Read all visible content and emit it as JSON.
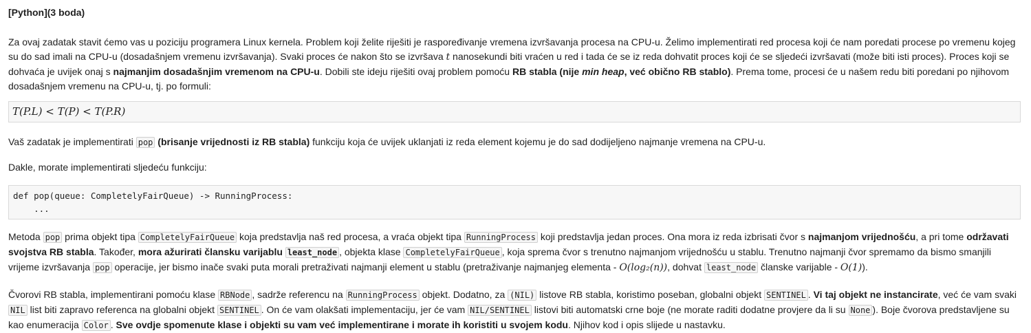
{
  "heading": "[Python](3 boda)",
  "intro": {
    "t1": "Za ovaj zadatak stavit ćemo vas u poziciju programera Linux kernela. Problem koji želite riješiti je raspoređivanje vremena izvršavanja procesa na CPU-u. Želimo implementirati red procesa koji će nam poredati procese po vremenu kojeg su do sad imali na CPU-u (dosadašnjem vremenu izvršavanja). Svaki proces će nakon što se izvršava ",
    "t_var": "t",
    "t2": " nanosekundi biti vraćen u red i tada će se iz reda dohvatit proces koji će se sljedeći izvršavati (može biti isti proces). Proces koji se dohvaća je uvijek onaj s ",
    "b1": "najmanjim dosadašnjim vremenom na CPU-u",
    "t3": ". Dobili ste ideju riješiti ovaj problem pomoću ",
    "b2a": "RB stabla (nije ",
    "b2i": "min heap",
    "b2b": ", već obično RB stablo)",
    "t4": ". Prema tome, procesi će u našem redu biti poredani po njihovom dosadašnjem vremenu na CPU-u, tj. po formuli:"
  },
  "formula": "T(P.L) < T(P) < T(P.R)",
  "pop_para": {
    "t1": "Vaš zadatak je implementirati ",
    "code": "pop",
    "b1": " (brisanje vrijednosti iz RB stabla)",
    "t2": " funkciju koja će uvijek uklanjati iz reda element kojemu je do sad dodijeljeno najmanje vremena na CPU-u."
  },
  "dakle": "Dakle, morate implementirati sljedeću funkciju:",
  "code_block": {
    "line1": "def pop(queue: CompletelyFairQueue) -> RunningProcess:",
    "line2": "    ..."
  },
  "metoda": {
    "t1": "Metoda ",
    "c1": "pop",
    "t2": " prima objekt tipa ",
    "c2": "CompletelyFairQueue",
    "t3": " koja predstavlja naš red procesa, a vraća objekt tipa ",
    "c3": "RunningProcess",
    "t4": " koji predstavlja jedan proces. Ona mora iz reda izbrisati čvor s ",
    "b1": "najmanjom vrijednošću",
    "t5": ", a pri tome ",
    "b2": "održavati svojstva RB stabla",
    "t6": ". Također, ",
    "b3": "mora ažurirati člansku varijablu ",
    "c4": "least_node",
    "t7": ", objekta klase ",
    "c5": "CompletelyFairQueue",
    "t8": ", koja sprema čvor s trenutno najmanjom vrijednošću u stablu. Trenutno najmanji čvor spremamo da bismo smanjili vrijeme izvršavanja ",
    "c6": "pop",
    "t9": " operacije, jer bismo inače svaki puta morali pretraživati najmanji element u stablu (pretraživanje najmanjeg elementa - ",
    "m1": "O(log₂(n))",
    "t10": ", dohvat ",
    "c7": "least_node",
    "t11": " članske varijable - ",
    "m2": "O(1)",
    "t12": ")."
  },
  "cvorovi": {
    "t1": "Čvorovi RB stabla, implementirani pomoću klase ",
    "c1": "RBNode",
    "t2": ", sadrže referencu na ",
    "c2": "RunningProcess",
    "t3": " objekt. Dodatno, za ",
    "c3": "(NIL)",
    "t4": " listove RB stabla, koristimo poseban, globalni objekt ",
    "c4": "SENTINEL",
    "t5": ". ",
    "b1": "Vi taj objekt ne instancirate",
    "t6": ", već će vam svaki ",
    "c5": "NIL",
    "t7": " list biti zapravo referenca na globalni objekt ",
    "c6": "SENTINEL",
    "t8": ". On će vam olakšati implementaciju, jer će vam ",
    "c7": "NIL/SENTINEL",
    "t9": " listovi biti automatski crne boje (ne morate raditi dodatne provjere da li su ",
    "c8": "None",
    "t10": "). Boje čvorova predstavljene su kao enumeracija ",
    "c9": "Color",
    "t11": ". ",
    "b2": "Sve ovdje spomenute klase i objekti su vam već implementirane i morate ih koristiti u svojem kodu",
    "t12": ". Njihov kod i opis slijede u nastavku."
  }
}
